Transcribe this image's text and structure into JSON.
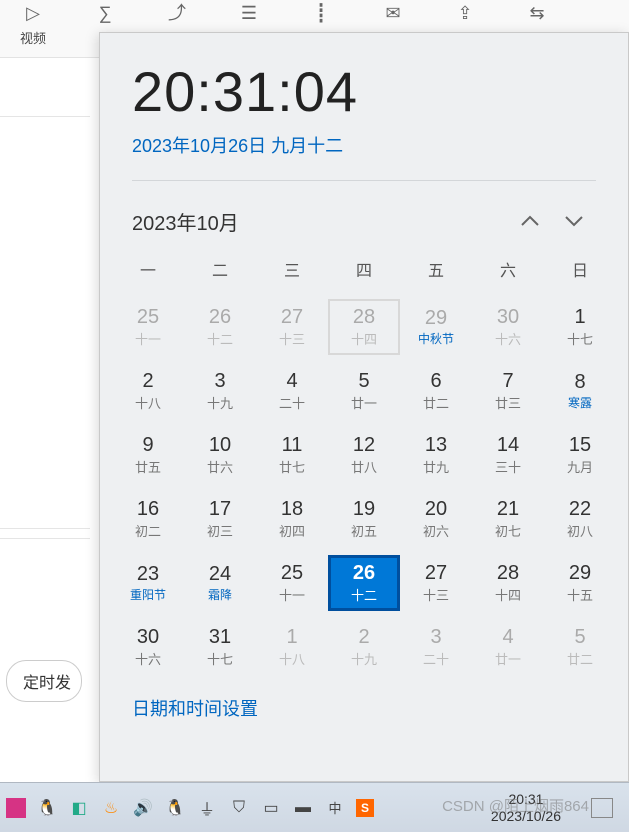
{
  "ribbon": {
    "items": [
      {
        "icon": "▷",
        "label": "视频"
      },
      {
        "icon": "∑",
        "label": ""
      },
      {
        "icon": "⤴",
        "label": ""
      },
      {
        "icon": "☰",
        "label": ""
      },
      {
        "icon": "┋",
        "label": ""
      },
      {
        "icon": "✉",
        "label": ""
      },
      {
        "icon": "⇪",
        "label": ""
      },
      {
        "icon": "⇆",
        "label": ""
      }
    ]
  },
  "schedule_button": "定时发",
  "flyout": {
    "time": "20:31:04",
    "date_line": "2023年10月26日 九月十二",
    "month_label": "2023年10月",
    "weekdays": [
      "一",
      "二",
      "三",
      "四",
      "五",
      "六",
      "日"
    ],
    "days": [
      {
        "n": "25",
        "s": "十一",
        "other": true
      },
      {
        "n": "26",
        "s": "十二",
        "other": true
      },
      {
        "n": "27",
        "s": "十三",
        "other": true
      },
      {
        "n": "28",
        "s": "十四",
        "other": true,
        "outline": true
      },
      {
        "n": "29",
        "s": "中秋节",
        "other": true,
        "hol": true
      },
      {
        "n": "30",
        "s": "十六",
        "other": true
      },
      {
        "n": "1",
        "s": "十七"
      },
      {
        "n": "2",
        "s": "十八"
      },
      {
        "n": "3",
        "s": "十九"
      },
      {
        "n": "4",
        "s": "二十"
      },
      {
        "n": "5",
        "s": "廿一"
      },
      {
        "n": "6",
        "s": "廿二"
      },
      {
        "n": "7",
        "s": "廿三"
      },
      {
        "n": "8",
        "s": "寒露",
        "hol": true
      },
      {
        "n": "9",
        "s": "廿五"
      },
      {
        "n": "10",
        "s": "廿六"
      },
      {
        "n": "11",
        "s": "廿七"
      },
      {
        "n": "12",
        "s": "廿八"
      },
      {
        "n": "13",
        "s": "廿九"
      },
      {
        "n": "14",
        "s": "三十"
      },
      {
        "n": "15",
        "s": "九月"
      },
      {
        "n": "16",
        "s": "初二"
      },
      {
        "n": "17",
        "s": "初三"
      },
      {
        "n": "18",
        "s": "初四"
      },
      {
        "n": "19",
        "s": "初五"
      },
      {
        "n": "20",
        "s": "初六"
      },
      {
        "n": "21",
        "s": "初七"
      },
      {
        "n": "22",
        "s": "初八"
      },
      {
        "n": "23",
        "s": "重阳节",
        "hol": true
      },
      {
        "n": "24",
        "s": "霜降",
        "hol": true
      },
      {
        "n": "25",
        "s": "十一"
      },
      {
        "n": "26",
        "s": "十二",
        "selected": true
      },
      {
        "n": "27",
        "s": "十三"
      },
      {
        "n": "28",
        "s": "十四"
      },
      {
        "n": "29",
        "s": "十五"
      },
      {
        "n": "30",
        "s": "十六"
      },
      {
        "n": "31",
        "s": "十七"
      },
      {
        "n": "1",
        "s": "十八",
        "other": true
      },
      {
        "n": "2",
        "s": "十九",
        "other": true
      },
      {
        "n": "3",
        "s": "二十",
        "other": true
      },
      {
        "n": "4",
        "s": "廿一",
        "other": true
      },
      {
        "n": "5",
        "s": "廿二",
        "other": true
      }
    ],
    "settings_link": "日期和时间设置"
  },
  "taskbar": {
    "icons": [
      "app-pink",
      "qq",
      "puzzle",
      "flame",
      "volume",
      "penguin",
      "wifi",
      "shield",
      "desktop",
      "battery",
      "ime",
      "sogou"
    ],
    "clock_time": "20:31",
    "clock_date": "2023/10/26"
  },
  "watermark": "CSDN @陌上烟雨864"
}
